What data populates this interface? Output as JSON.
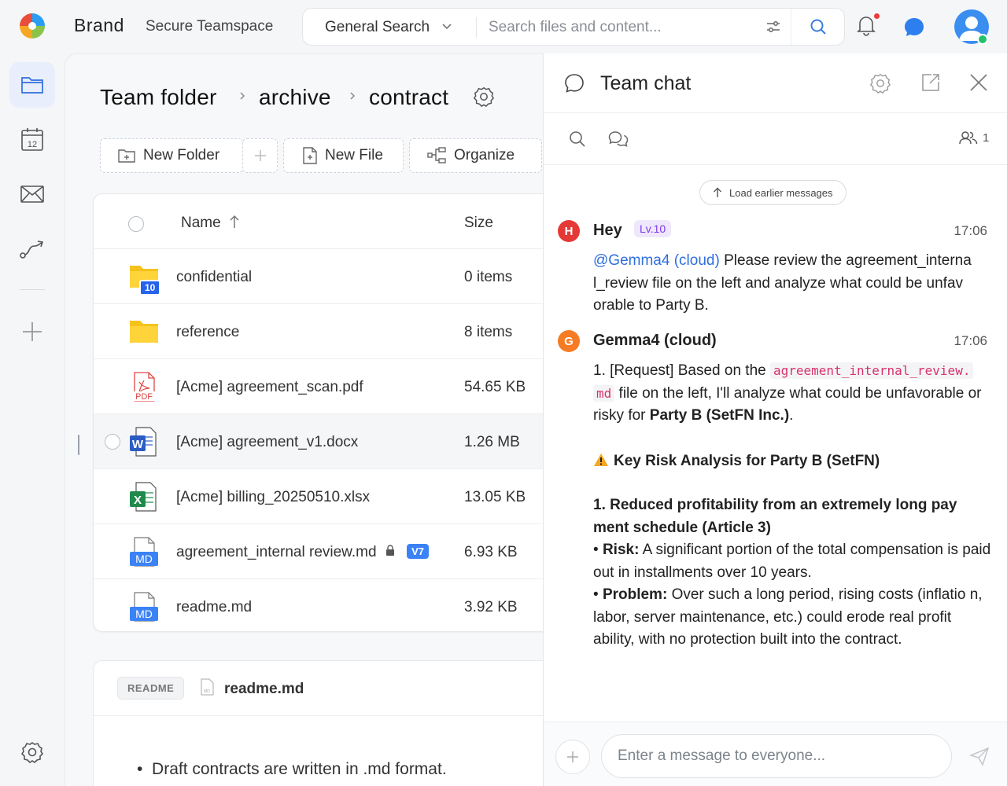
{
  "header": {
    "brand": "Brand",
    "workspace": "Secure Teamspace",
    "search_scope": "General Search",
    "search_placeholder": "Search files and content..."
  },
  "breadcrumb": [
    "Team folder",
    "archive",
    "contract"
  ],
  "toolbar": {
    "new_folder": "New Folder",
    "new_file": "New File",
    "organize": "Organize"
  },
  "files": {
    "col_name": "Name",
    "col_size": "Size",
    "rows": [
      {
        "name": "confidential",
        "size": "0 items",
        "type": "folder",
        "badge": "10"
      },
      {
        "name": "reference",
        "size": "8 items",
        "type": "folder"
      },
      {
        "name": "[Acme] agreement_scan.pdf",
        "size": "54.65 KB",
        "type": "pdf",
        "icon_text": "PDF"
      },
      {
        "name": "[Acme] agreement_v1.docx",
        "size": "1.26 MB",
        "type": "docx",
        "icon_text": "W"
      },
      {
        "name": "[Acme] billing_20250510.xlsx",
        "size": "13.05 KB",
        "type": "xlsx",
        "icon_text": "X"
      },
      {
        "name": "agreement_internal review.md",
        "size": "6.93 KB",
        "type": "md",
        "icon_text": "MD",
        "version": "V7"
      },
      {
        "name": "readme.md",
        "size": "3.92 KB",
        "type": "md",
        "icon_text": "MD"
      }
    ]
  },
  "readme": {
    "tag": "README",
    "icon_text": "MD",
    "title": "readme.md",
    "bullet": "Draft contracts are written in .md format."
  },
  "rail": {
    "calendar_day": "12"
  },
  "chat": {
    "title": "Team chat",
    "member_count": "1",
    "load_earlier": "Load earlier messages",
    "messages": [
      {
        "initial": "H",
        "author": "Hey",
        "level": "Lv.10",
        "time": "17:06",
        "mention": "@Gemma4 (cloud)",
        "text": "Please review the agreement_interna l_review file on the left and analyze what could be unfav orable to Party B."
      },
      {
        "initial": "G",
        "author": "Gemma4 (cloud)",
        "time": "17:06",
        "p1_a": "1. [Request] Based on the",
        "p1_code1": "agreement_internal_review.",
        "p1_code2": "md",
        "p1_b": "file on the left, I'll analyze what could be unfavorable or risky for",
        "p1_bold": "Party B (SetFN Inc.)",
        "p1_c": ".",
        "heading": "Key Risk Analysis for Party B (SetFN)",
        "sub_heading": "1. Reduced profitability from an extremely long pay ment schedule (Article 3)",
        "risk_label": "Risk:",
        "risk_text": "A significant portion of the total compensation is paid out in installments over 10 years.",
        "problem_label": "Problem:",
        "problem_text": "Over such a long period, rising costs (inflatio n, labor, server maintenance, etc.) could erode real profit ability, with no protection built into the contract."
      }
    ],
    "input_placeholder": "Enter a message to everyone..."
  },
  "colors": {
    "accent": "#2f6fde",
    "folder": "#f5c21b",
    "pdf": "#e04646",
    "word": "#2b5cc4",
    "excel": "#1f8a4c",
    "md": "#3b82f6"
  }
}
